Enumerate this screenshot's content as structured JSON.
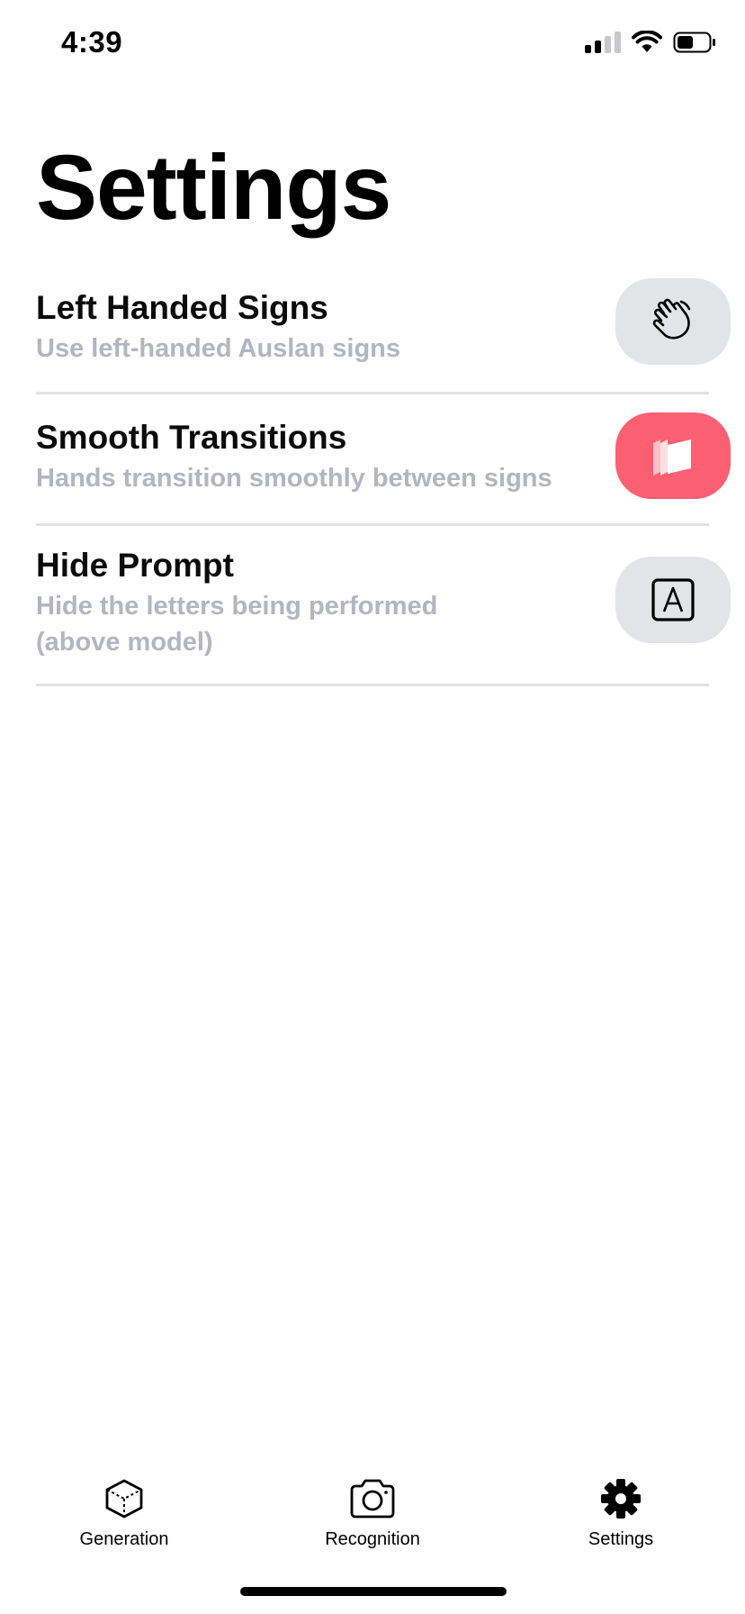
{
  "status_bar": {
    "time": "4:39"
  },
  "page": {
    "title": "Settings"
  },
  "settings": [
    {
      "title": "Left Handed Signs",
      "subtitle": "Use left-handed Auslan signs",
      "icon": "hand-wave-icon",
      "enabled": false
    },
    {
      "title": "Smooth Transitions",
      "subtitle": "Hands transition smoothly between signs",
      "icon": "layers-icon",
      "enabled": true
    },
    {
      "title": "Hide Prompt",
      "subtitle": "Hide the letters being performed (above model)",
      "icon": "letter-a-box-icon",
      "enabled": false
    }
  ],
  "tabs": [
    {
      "label": "Generation",
      "icon": "cube-icon",
      "selected": false
    },
    {
      "label": "Recognition",
      "icon": "camera-icon",
      "selected": false
    },
    {
      "label": "Settings",
      "icon": "gear-icon",
      "selected": true
    }
  ],
  "colors": {
    "accent": "#fd5f72",
    "toggle_off": "#e3e4e8",
    "subtitle": "#b4b4c3",
    "divider": "#e3e3e6"
  }
}
